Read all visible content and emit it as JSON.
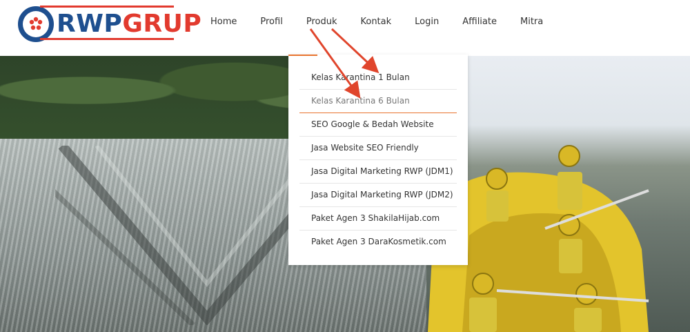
{
  "brand": {
    "logo_text_primary": "RWP",
    "logo_text_secondary": "GRUP",
    "brand_color": "#1e4f8f",
    "accent_color": "#e23a2e"
  },
  "nav": {
    "items": [
      {
        "label": "Home"
      },
      {
        "label": "Profil"
      },
      {
        "label": "Produk"
      },
      {
        "label": "Kontak"
      },
      {
        "label": "Login"
      },
      {
        "label": "Affiliate"
      },
      {
        "label": "Mitra"
      }
    ]
  },
  "dropdown": {
    "open_under": "Produk",
    "highlight_color": "#e8742f",
    "items": [
      {
        "label": "Kelas Karantina 1 Bulan"
      },
      {
        "label": "Kelas Karantina 6 Bulan"
      },
      {
        "label": "SEO Google & Bedah Website"
      },
      {
        "label": "Jasa Website SEO Friendly"
      },
      {
        "label": "Jasa Digital Marketing RWP (JDM1)"
      },
      {
        "label": "Jasa Digital Marketing RWP (JDM2)"
      },
      {
        "label": "Paket Agen 3 ShakilaHijab.com"
      },
      {
        "label": "Paket Agen 3 DaraKosmetik.com"
      }
    ]
  },
  "annotation": {
    "arrow_color": "#e0452c",
    "arrow_icon": "red-arrow-icon"
  }
}
